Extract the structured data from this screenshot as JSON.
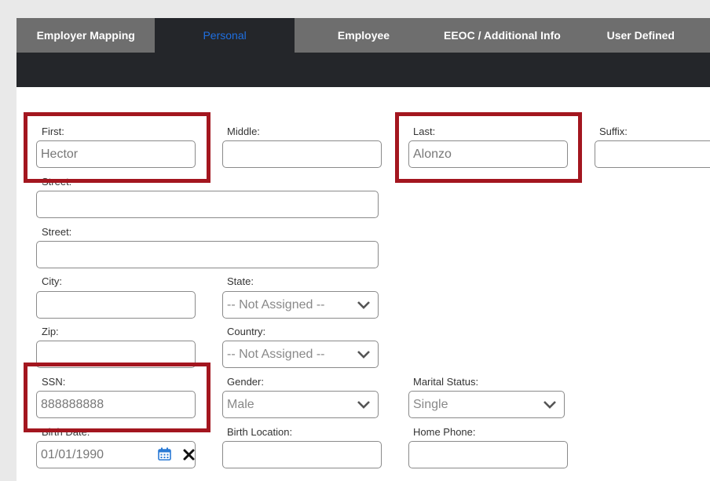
{
  "tabs": [
    {
      "label": "Employer Mapping",
      "active": false
    },
    {
      "label": "Personal",
      "active": true
    },
    {
      "label": "Employee",
      "active": false
    },
    {
      "label": "EEOC / Additional Info",
      "active": false
    },
    {
      "label": "User Defined",
      "active": false
    }
  ],
  "form": {
    "first": {
      "label": "First:",
      "value": "Hector"
    },
    "middle": {
      "label": "Middle:",
      "value": ""
    },
    "last": {
      "label": "Last:",
      "value": "Alonzo"
    },
    "suffix": {
      "label": "Suffix:",
      "value": ""
    },
    "street1": {
      "label": "Street:",
      "value": ""
    },
    "street2": {
      "label": "Street:",
      "value": ""
    },
    "city": {
      "label": "City:",
      "value": ""
    },
    "state": {
      "label": "State:",
      "value": "-- Not Assigned --"
    },
    "zip": {
      "label": "Zip:",
      "value": ""
    },
    "country": {
      "label": "Country:",
      "value": "-- Not Assigned --"
    },
    "ssn": {
      "label": "SSN:",
      "value": "888888888"
    },
    "gender": {
      "label": "Gender:",
      "value": "Male"
    },
    "marital_status": {
      "label": "Marital Status:",
      "value": "Single"
    },
    "birth_date": {
      "label": "Birth Date:",
      "value": "01/01/1990"
    },
    "birth_location": {
      "label": "Birth Location:",
      "value": ""
    },
    "home_phone": {
      "label": "Home Phone:",
      "value": ""
    }
  },
  "colors": {
    "highlight": "#a3161f",
    "tab_active_text": "#1f6fe0",
    "tab_bar": "#6e6e6e",
    "dark_bar": "#24262a",
    "calendar_icon": "#2a7ad5"
  },
  "icons": {
    "calendar": "calendar-icon",
    "clear": "clear-x-icon",
    "dropdown": "chevron-down-icon"
  }
}
